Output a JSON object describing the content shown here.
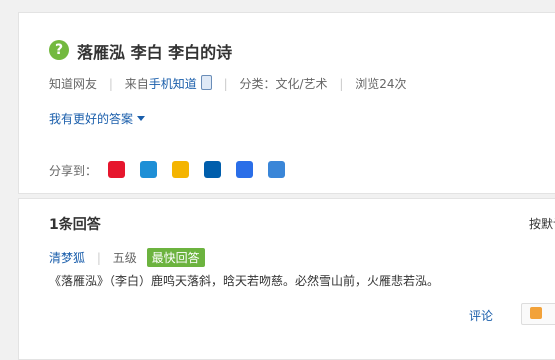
{
  "question": {
    "icon": "question-mark-icon",
    "icon_glyph": "?",
    "title": "落雁泓 李白 李白的诗",
    "meta": {
      "asker": "知道网友",
      "source_prefix": "来自",
      "source_link": "手机知道",
      "category": "分类：文化/艺术",
      "views": "浏览24次"
    },
    "better_answer_link": "我有更好的答案",
    "share_label": "分享到：",
    "share_icons": [
      {
        "name": "weibo-icon",
        "color": "#e6162d"
      },
      {
        "name": "tencent-weibo-icon",
        "color": "#1e8fd6"
      },
      {
        "name": "qzone-icon",
        "color": "#f4b400"
      },
      {
        "name": "renren-icon",
        "color": "#005eac"
      },
      {
        "name": "tieba-icon",
        "color": "#2a6ee8"
      },
      {
        "name": "more-share-icon",
        "color": "#3a86d8"
      }
    ]
  },
  "answers": {
    "count_label": "1条回答",
    "sort_label": "按默认",
    "items": [
      {
        "user": "清梦狐",
        "level": "五级",
        "badge": "最快回答",
        "text": "《落雁泓》（李白）鹿鸣天落斜，晗天若吻慈。必然雪山前，火雁悲若泓。",
        "comment_label": "评论"
      }
    ]
  }
}
